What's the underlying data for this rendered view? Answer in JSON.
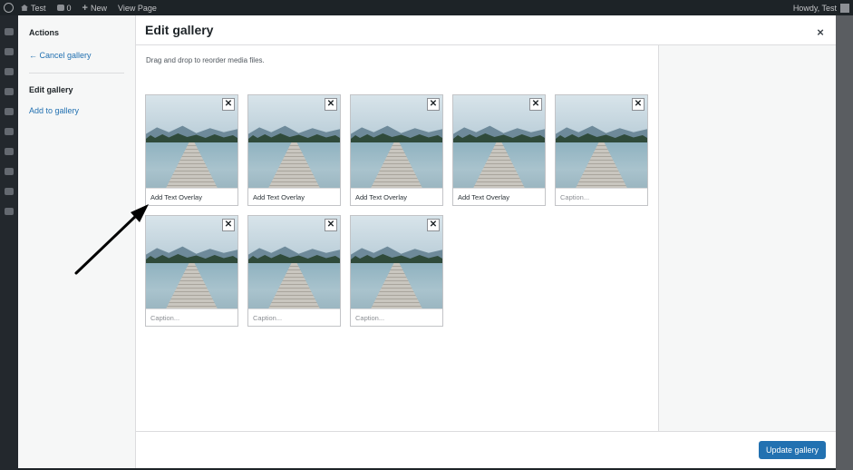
{
  "adminbar": {
    "site_name": "Test",
    "comments_count": "0",
    "new_label": "New",
    "view_page_label": "View Page",
    "greeting": "Howdy, Test"
  },
  "modal": {
    "menu": {
      "heading": "Actions",
      "cancel_label": "← Cancel gallery",
      "active_label": "Edit gallery",
      "add_label": "Add to gallery"
    },
    "title": "Edit gallery",
    "close_symbol": "×",
    "instructions": "Drag and drop to reorder media files.",
    "update_label": "Update gallery",
    "remove_symbol": "✕",
    "items": [
      {
        "caption": "Add Text Overlay"
      },
      {
        "caption": "Add Text Overlay"
      },
      {
        "caption": "Add Text Overlay"
      },
      {
        "caption": "Add Text Overlay"
      },
      {
        "caption": "Caption..."
      },
      {
        "caption": "Caption..."
      },
      {
        "caption": "Caption..."
      },
      {
        "caption": "Caption..."
      }
    ]
  },
  "colors": {
    "accent": "#2271b1",
    "admin_bar": "#1d2327",
    "arrow": "#000000"
  },
  "icons": [
    "wordpress-logo-icon",
    "home-icon",
    "comment-bubble-icon",
    "plus-icon",
    "avatar-icon",
    "close-icon",
    "remove-icon",
    "annotation-arrow-icon"
  ]
}
